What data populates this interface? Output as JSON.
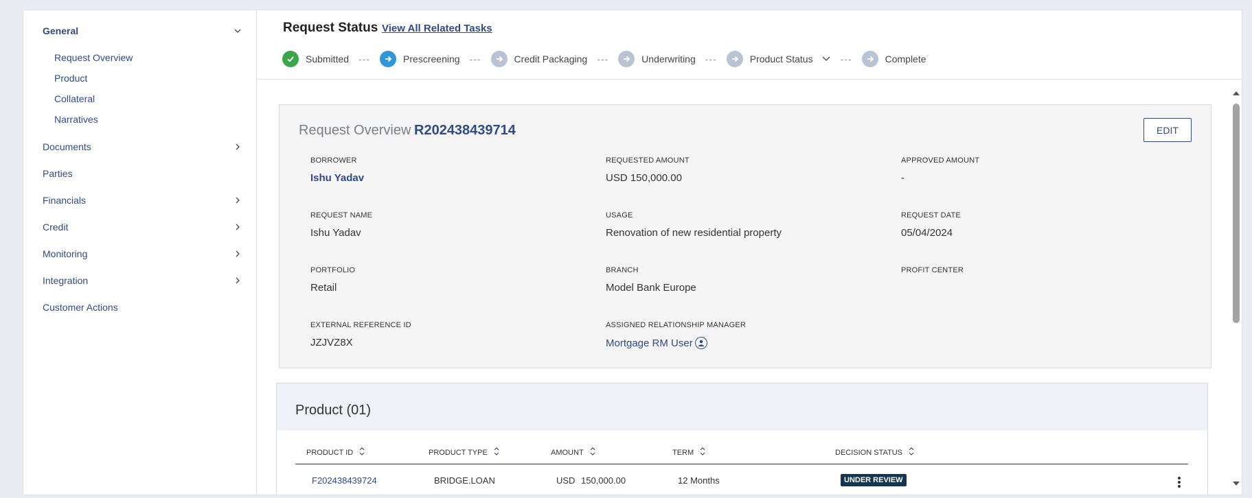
{
  "sidebar": {
    "general": "General",
    "sub_items": [
      "Request Overview",
      "Product",
      "Collateral",
      "Narratives"
    ],
    "items": [
      "Documents",
      "Parties",
      "Financials",
      "Credit",
      "Monitoring",
      "Integration",
      "Customer Actions"
    ]
  },
  "status": {
    "title": "Request Status",
    "link": "View All Related Tasks",
    "steps": [
      {
        "label": "Submitted",
        "state": "done"
      },
      {
        "label": "Prescreening",
        "state": "active"
      },
      {
        "label": "Credit Packaging",
        "state": "todo"
      },
      {
        "label": "Underwriting",
        "state": "todo"
      },
      {
        "label": "Product Status",
        "state": "todo"
      },
      {
        "label": "Complete",
        "state": "todo"
      }
    ],
    "separator": "---"
  },
  "overview": {
    "title": "Request Overview",
    "id": "R202438439714",
    "edit_label": "EDIT",
    "fields": {
      "borrower_label": "BORROWER",
      "borrower": "Ishu Yadav",
      "requested_amount_label": "REQUESTED AMOUNT",
      "requested_amount": "USD 150,000.00",
      "approved_amount_label": "APPROVED AMOUNT",
      "approved_amount": "-",
      "request_name_label": "REQUEST NAME",
      "request_name": "Ishu Yadav",
      "usage_label": "USAGE",
      "usage": "Renovation of new residential property",
      "request_date_label": "REQUEST DATE",
      "request_date": "05/04/2024",
      "portfolio_label": "PORTFOLIO",
      "portfolio": "Retail",
      "branch_label": "BRANCH",
      "branch": "Model Bank Europe",
      "profit_center_label": "PROFIT CENTER",
      "external_ref_label": "EXTERNAL REFERENCE ID",
      "external_ref": "JZJVZ8X",
      "rm_label": "ASSIGNED RELATIONSHIP MANAGER",
      "rm": "Mortgage RM User"
    }
  },
  "product": {
    "title": "Product (01)",
    "columns": [
      "PRODUCT ID",
      "PRODUCT TYPE",
      "AMOUNT",
      "TERM",
      "DECISION STATUS"
    ],
    "row": {
      "product_id": "F202438439724",
      "product_type": "BRIDGE.LOAN",
      "currency": "USD",
      "amount": "150,000.00",
      "term": "12 Months",
      "status": "UNDER REVIEW"
    }
  },
  "colors": {
    "accent": "#2f4a86",
    "done": "#3aa54a",
    "active": "#2f96d8",
    "todo": "#b8c3d4",
    "badge": "#12364f"
  }
}
